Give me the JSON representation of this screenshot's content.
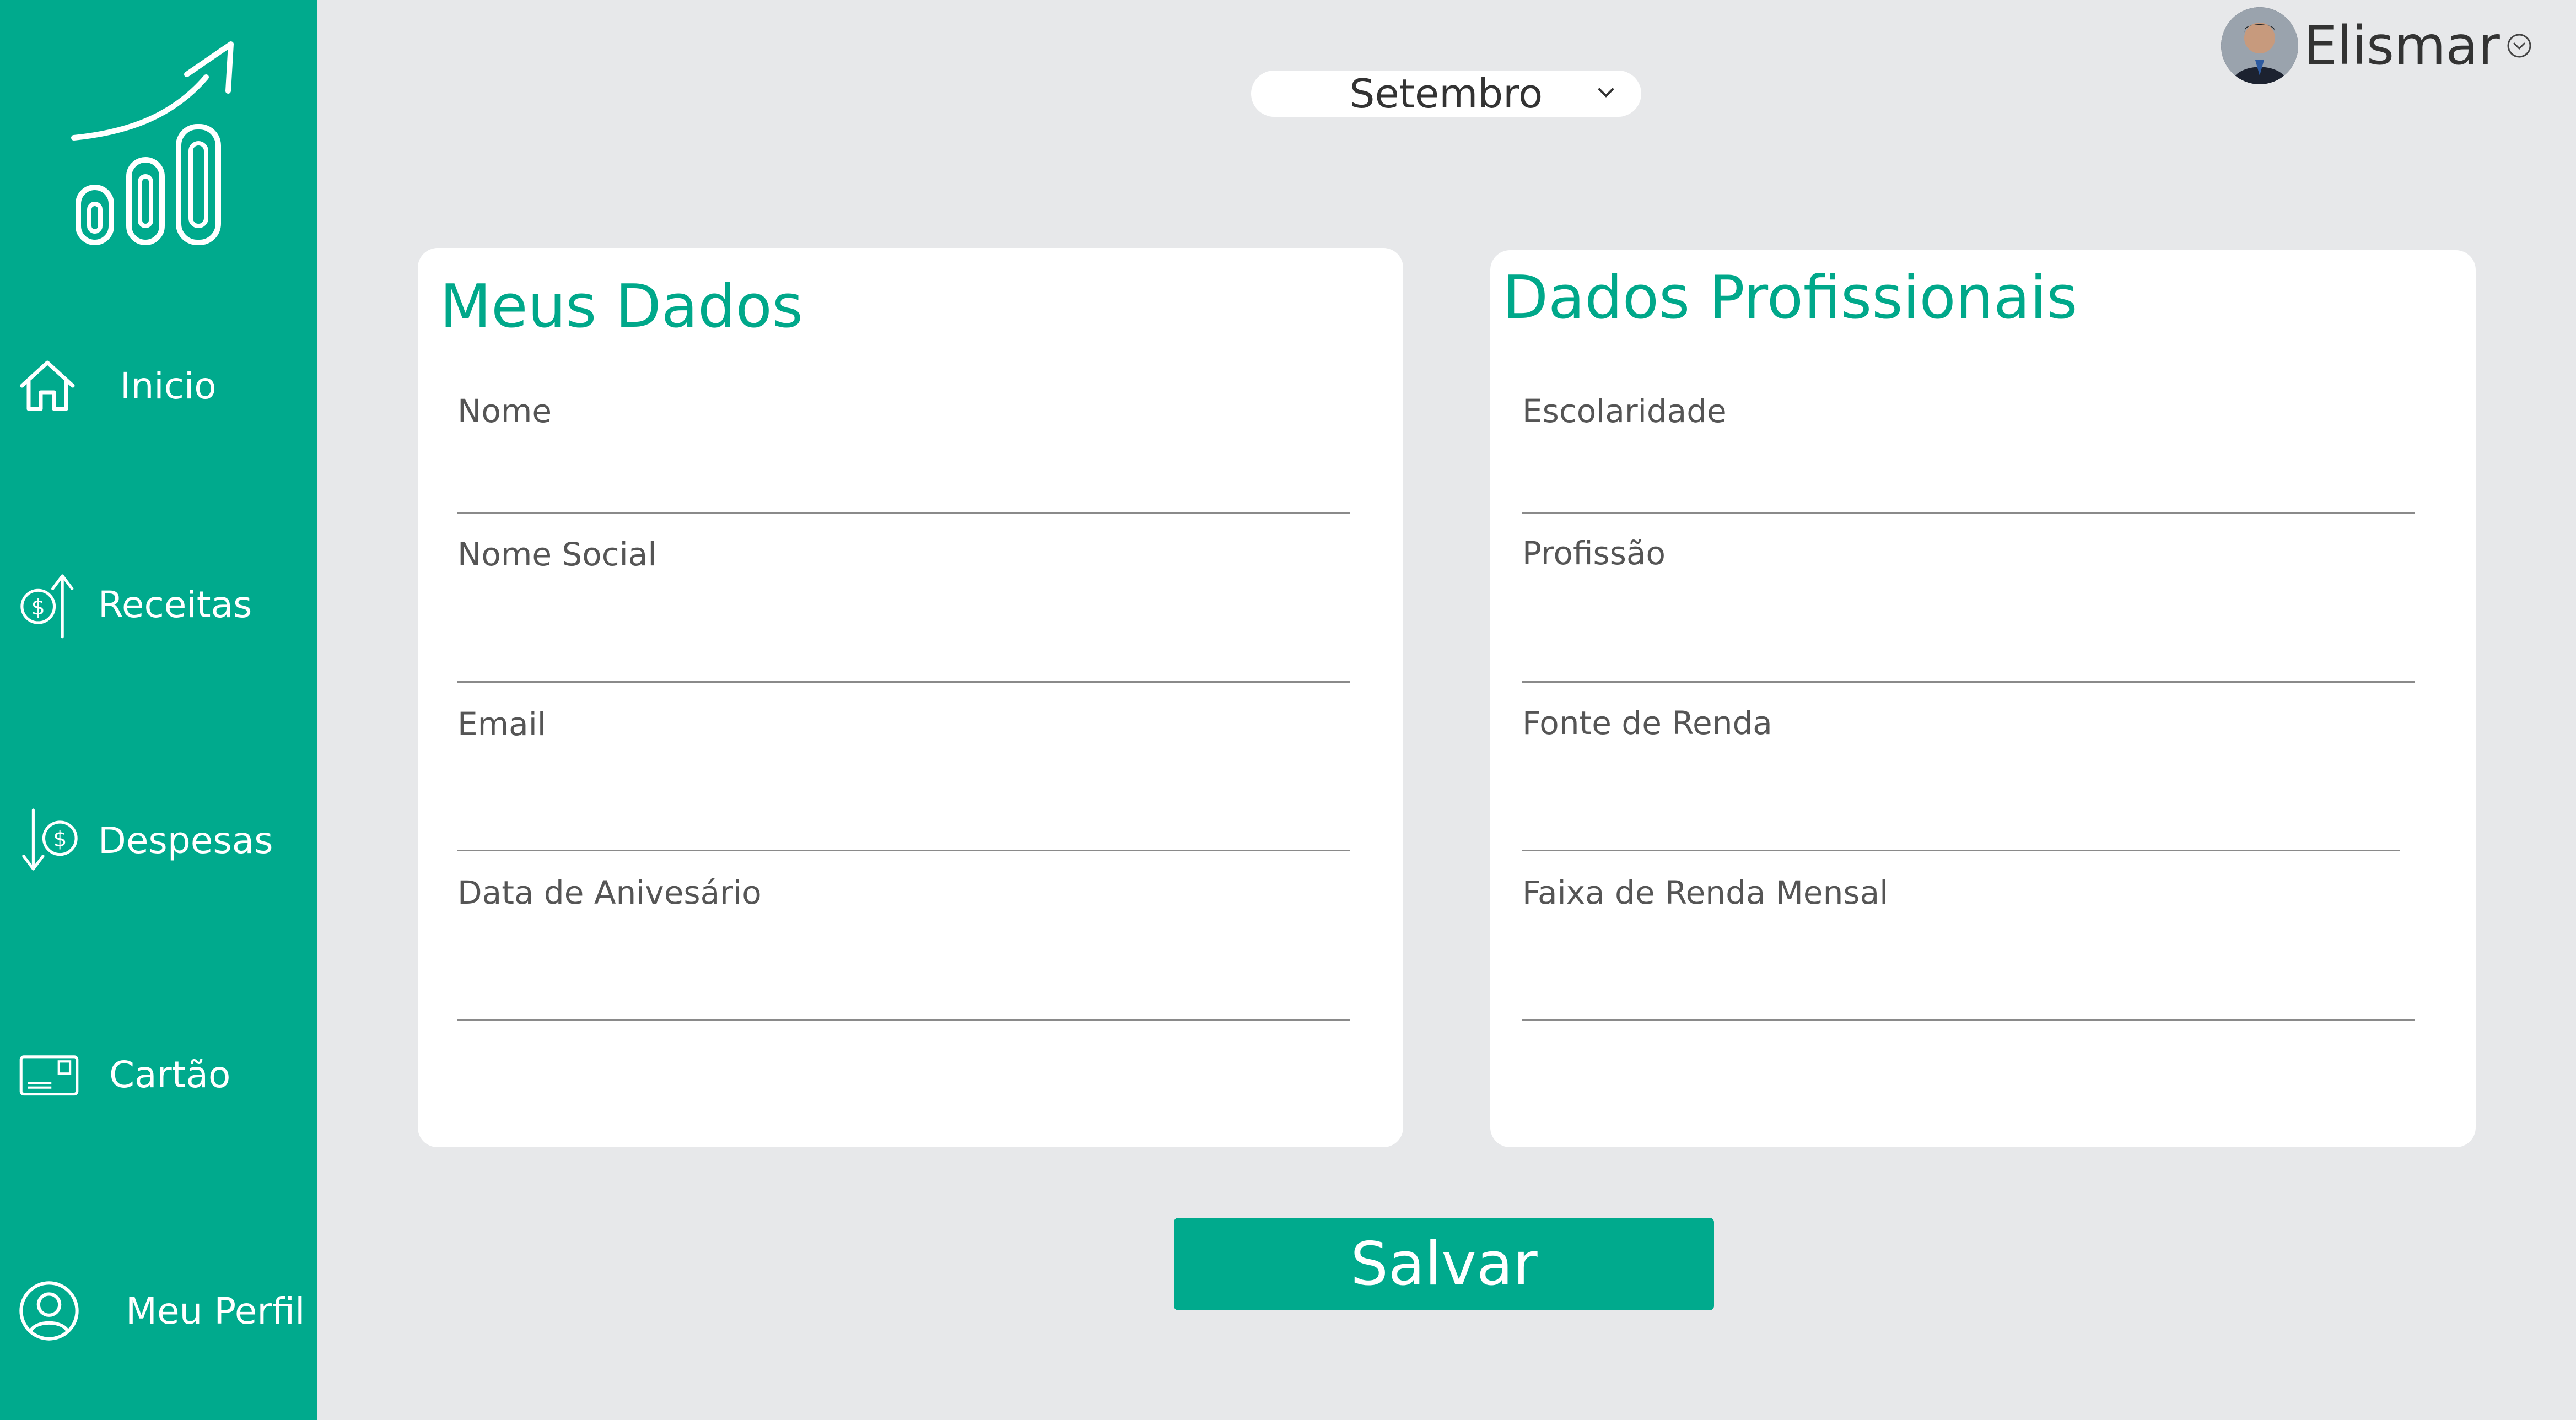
{
  "sidebar": {
    "items": [
      {
        "label": "Inicio",
        "icon": "home-icon"
      },
      {
        "label": "Receitas",
        "icon": "income-icon"
      },
      {
        "label": "Despesas",
        "icon": "expense-icon"
      },
      {
        "label": "Cartão",
        "icon": "card-icon"
      },
      {
        "label": "Meu Perfil",
        "icon": "user-icon"
      }
    ]
  },
  "header": {
    "month": "Setembro",
    "user_name": "Elismar"
  },
  "meus_dados": {
    "title": "Meus Dados",
    "fields": [
      {
        "label": "Nome"
      },
      {
        "label": "Nome Social"
      },
      {
        "label": "Email"
      },
      {
        "label": "Data de Anivesário"
      }
    ]
  },
  "dados_profissionais": {
    "title": "Dados Profissionais",
    "fields": [
      {
        "label": "Escolaridade"
      },
      {
        "label": "Profissão"
      },
      {
        "label": "Fonte de Renda"
      },
      {
        "label": "Faixa de Renda Mensal"
      }
    ]
  },
  "actions": {
    "save_label": "Salvar"
  },
  "colors": {
    "accent": "#00aa8d",
    "background": "#e7e8ea"
  }
}
